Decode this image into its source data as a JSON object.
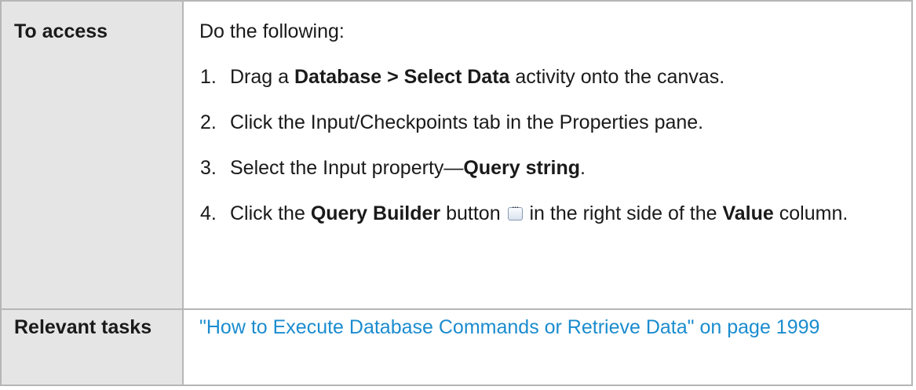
{
  "rows": {
    "access": {
      "label": "To access",
      "intro": "Do the following:",
      "steps": [
        {
          "num": "1.",
          "pre": "Drag a ",
          "bold": "Database > Select Data",
          "post": " activity onto the canvas."
        },
        {
          "num": "2.",
          "text": "Click the Input/Checkpoints tab in the Properties pane."
        },
        {
          "num": "3.",
          "pre": "Select the Input property—",
          "bold": "Query string",
          "post": "."
        },
        {
          "num": "4.",
          "pre": "Click the ",
          "bold": "Query Builder",
          "mid": " button ",
          "post": " in the right side of the ",
          "bold2": "Value",
          "post2": " column."
        }
      ]
    },
    "tasks": {
      "label": "Relevant tasks",
      "link_text": "\"How to Execute Database Commands or Retrieve Data\" on page 1999"
    }
  },
  "icons": {
    "query_builder_button": "ellipsis-button-icon"
  },
  "colors": {
    "label_background": "#e5e5e5",
    "border": "#b6b6b6",
    "link": "#1b8ccf"
  }
}
